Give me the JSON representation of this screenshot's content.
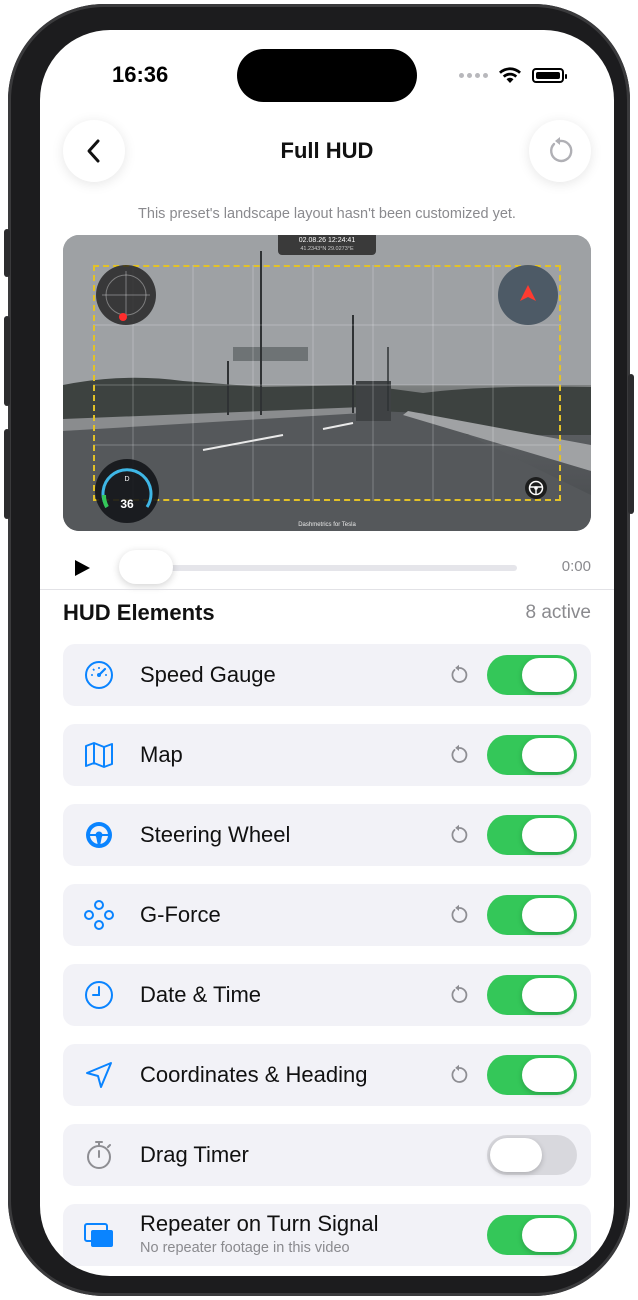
{
  "status_bar": {
    "time": "16:36"
  },
  "nav": {
    "title": "Full HUD",
    "back_icon": "chevron-left-icon",
    "reset_icon": "reset-icon"
  },
  "notice": "This preset's landscape layout hasn't been customized yet.",
  "video": {
    "timestamp": "02.08.26 12:24:41",
    "coordinates": "41.2343°N 29.0273°E",
    "brand": "Dashmetrics for Tesla",
    "speed": "36",
    "gear": "D"
  },
  "playback": {
    "time": "0:00",
    "progress": 0
  },
  "section": {
    "title": "HUD Elements",
    "count": "8 active"
  },
  "elements": [
    {
      "label": "Speed Gauge",
      "icon": "speedometer-icon",
      "enabled": true,
      "resettable": true
    },
    {
      "label": "Map",
      "icon": "map-icon",
      "enabled": true,
      "resettable": true
    },
    {
      "label": "Steering Wheel",
      "icon": "steering-wheel-icon",
      "enabled": true,
      "resettable": true
    },
    {
      "label": "G-Force",
      "icon": "g-force-icon",
      "enabled": true,
      "resettable": true
    },
    {
      "label": "Date & Time",
      "icon": "clock-icon",
      "enabled": true,
      "resettable": true
    },
    {
      "label": "Coordinates & Heading",
      "icon": "location-arrow-icon",
      "enabled": true,
      "resettable": true
    },
    {
      "label": "Drag Timer",
      "icon": "stopwatch-icon",
      "enabled": false,
      "resettable": false
    },
    {
      "label": "Repeater on Turn Signal",
      "subtitle": "No repeater footage in this video",
      "icon": "repeater-windows-icon",
      "enabled": true,
      "resettable": false
    }
  ],
  "colors": {
    "accent": "#0a84ff",
    "toggle_on": "#34c759",
    "hud_guide": "#e3c227"
  }
}
